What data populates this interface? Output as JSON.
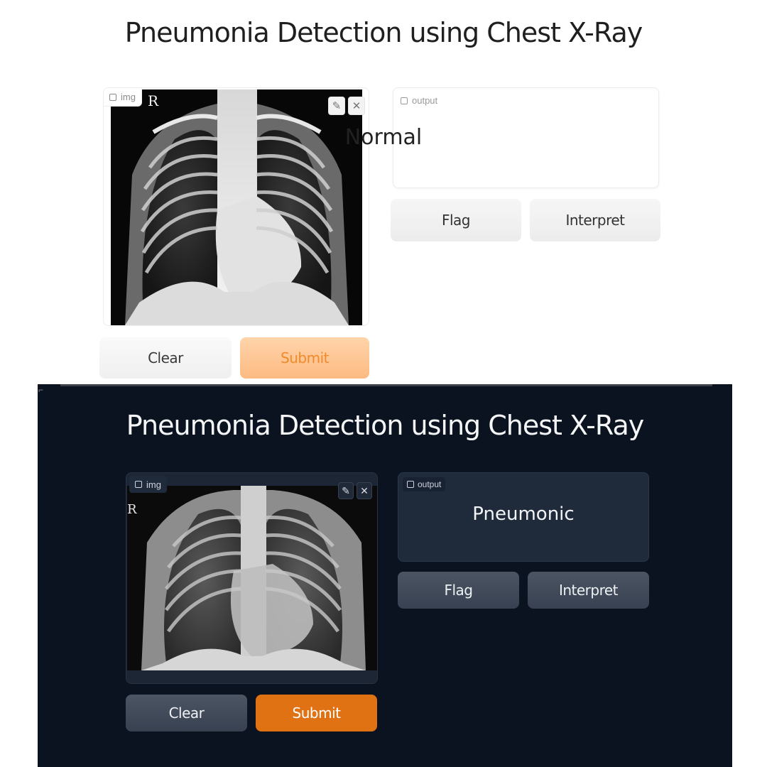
{
  "light_app": {
    "title": "Pneumonia Detection using Chest X-Ray",
    "input": {
      "label": "img",
      "marker": "R"
    },
    "tools": {
      "edit_icon": "✎",
      "close_icon": "✕"
    },
    "output": {
      "label": "output",
      "value": "Normal"
    },
    "buttons": {
      "clear": "Clear",
      "submit": "Submit",
      "flag": "Flag",
      "interpret": "Interpret"
    },
    "colors": {
      "background": "#ffffff",
      "submit_bg": "#fdc898",
      "submit_text": "#f08a2a"
    }
  },
  "dark_app": {
    "title": "Pneumonia Detection using Chest X-Ray",
    "input": {
      "label": "img",
      "marker": "R"
    },
    "tools": {
      "edit_icon": "✎",
      "close_icon": "✕"
    },
    "output": {
      "label": "output",
      "value": "Pneumonic"
    },
    "buttons": {
      "clear": "Clear",
      "submit": "Submit",
      "flag": "Flag",
      "interpret": "Interpret"
    },
    "colors": {
      "background": "#0c1320",
      "submit_bg": "#e07214",
      "button_bg": "#4b5563"
    }
  }
}
